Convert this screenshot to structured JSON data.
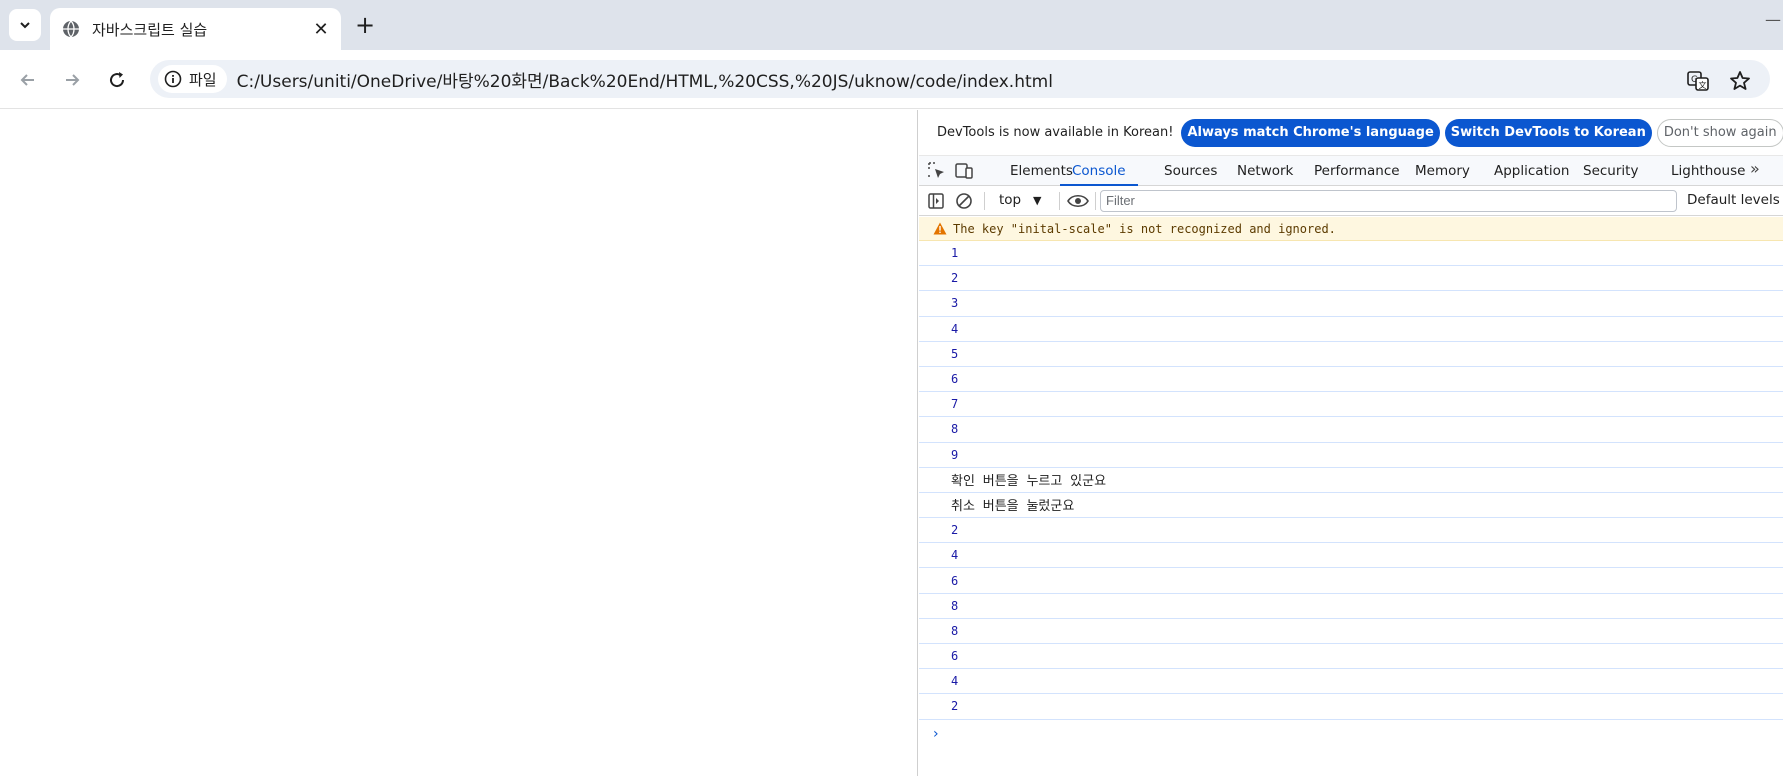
{
  "browser": {
    "tab": {
      "title": "자바스크립트 실습"
    },
    "address": {
      "scheme_chip": "파일",
      "url": "C:/Users/uniti/OneDrive/바탕%20화면/Back%20End/HTML,%20CSS,%20JS/uknow/code/index.html"
    }
  },
  "devtools": {
    "infobar": {
      "message": "DevTools is now available in Korean!",
      "buttons": [
        "Always match Chrome's language",
        "Switch DevTools to Korean",
        "Don't show again"
      ]
    },
    "tabs": [
      "Elements",
      "Console",
      "Sources",
      "Network",
      "Performance",
      "Memory",
      "Application",
      "Security",
      "Lighthouse"
    ],
    "active_tab": "Console",
    "console_toolbar": {
      "context": "top",
      "filter_placeholder": "Filter",
      "levels": "Default levels"
    },
    "warning": "The key \"inital-scale\" is not recognized and ignored.",
    "logs": [
      {
        "text": "1",
        "kind": "num"
      },
      {
        "text": "2",
        "kind": "num"
      },
      {
        "text": "3",
        "kind": "num"
      },
      {
        "text": "4",
        "kind": "num"
      },
      {
        "text": "5",
        "kind": "num"
      },
      {
        "text": "6",
        "kind": "num"
      },
      {
        "text": "7",
        "kind": "num"
      },
      {
        "text": "8",
        "kind": "num"
      },
      {
        "text": "9",
        "kind": "num"
      },
      {
        "text": "확인 버튼을 누르고 있군요",
        "kind": "str"
      },
      {
        "text": "취소 버튼을 눌렀군요",
        "kind": "str"
      },
      {
        "text": "2",
        "kind": "num"
      },
      {
        "text": "4",
        "kind": "num"
      },
      {
        "text": "6",
        "kind": "num"
      },
      {
        "text": "8",
        "kind": "num"
      },
      {
        "text": "8",
        "kind": "num"
      },
      {
        "text": "6",
        "kind": "num"
      },
      {
        "text": "4",
        "kind": "num"
      },
      {
        "text": "2",
        "kind": "num"
      }
    ],
    "prompt": "›"
  },
  "colors": {
    "accent": "#0b57d0",
    "warning_bg": "#fef7e0",
    "number_blue": "#1a1aa6"
  }
}
